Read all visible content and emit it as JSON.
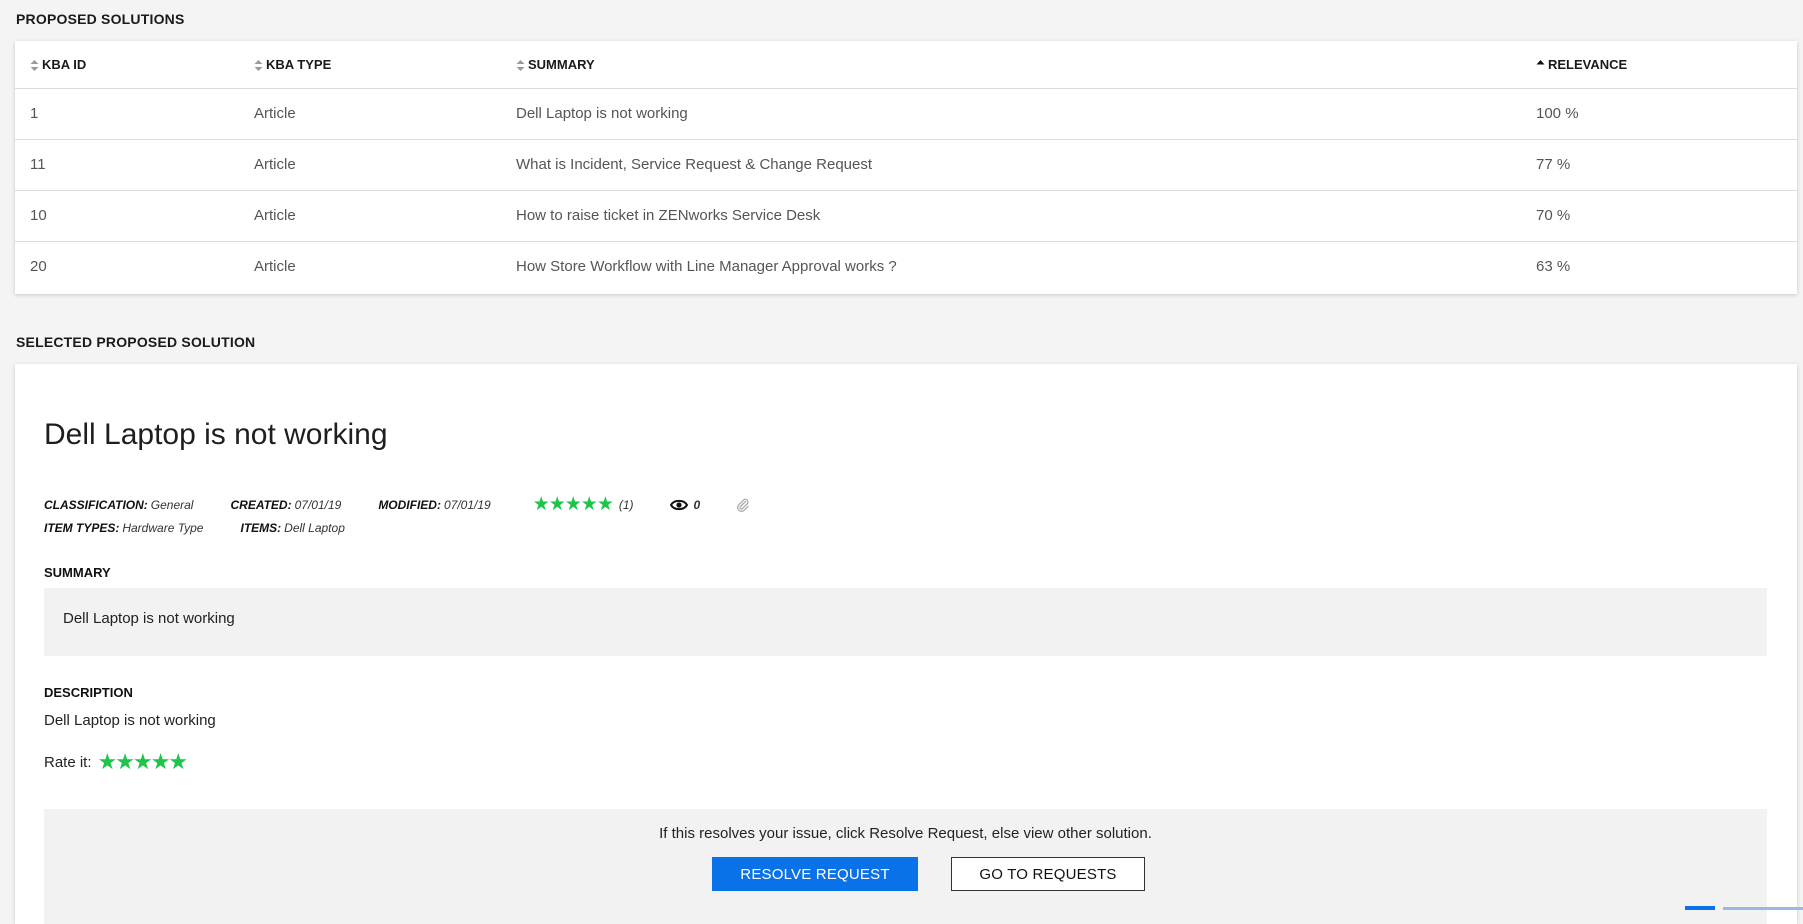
{
  "proposed": {
    "section_title": "PROPOSED SOLUTIONS",
    "columns": [
      {
        "label": "KBA ID",
        "sort": "none"
      },
      {
        "label": "KBA TYPE",
        "sort": "none"
      },
      {
        "label": "SUMMARY",
        "sort": "none"
      },
      {
        "label": "RELEVANCE",
        "sort": "ascending"
      }
    ],
    "rows": [
      {
        "id": "1",
        "type": "Article",
        "summary": "Dell Laptop is not working",
        "relevance": "100 %"
      },
      {
        "id": "11",
        "type": "Article",
        "summary": "What is Incident, Service Request & Change Request",
        "relevance": "77 %"
      },
      {
        "id": "10",
        "type": "Article",
        "summary": "How to raise ticket in ZENworks Service Desk",
        "relevance": "70 %"
      },
      {
        "id": "20",
        "type": "Article",
        "summary": "How Store Workflow with Line Manager Approval works ?",
        "relevance": "63 %"
      }
    ]
  },
  "selected": {
    "section_title": "SELECTED PROPOSED SOLUTION",
    "title": "Dell Laptop is not working",
    "meta": {
      "classification_label": "CLASSIFICATION:",
      "classification": "General",
      "created_label": "CREATED:",
      "created": "07/01/19",
      "modified_label": "MODIFIED:",
      "modified": "07/01/19",
      "rating_stars": "★★★★★",
      "rating_count": "(1)",
      "views": "0",
      "item_types_label": "ITEM TYPES:",
      "item_types": "Hardware Type",
      "items_label": "ITEMS:",
      "items": "Dell Laptop"
    },
    "summary_label": "SUMMARY",
    "summary": "Dell Laptop is not working",
    "description_label": "DESCRIPTION",
    "description": "Dell Laptop is not working",
    "rate_label": "Rate it:",
    "rate_stars": "★★★★★",
    "hint": "If this resolves your issue, click Resolve Request, else view other solution.",
    "resolve_button": "RESOLVE REQUEST",
    "go_button": "GO TO REQUESTS"
  },
  "colors": {
    "accent": "#0a72e8",
    "star": "#1fc54a",
    "background": "#f4f4f4"
  },
  "icons": {
    "sort": "sort-updown-icon",
    "sort_active": "sort-up-icon",
    "views": "eye-icon",
    "attachment": "paperclip-icon"
  }
}
